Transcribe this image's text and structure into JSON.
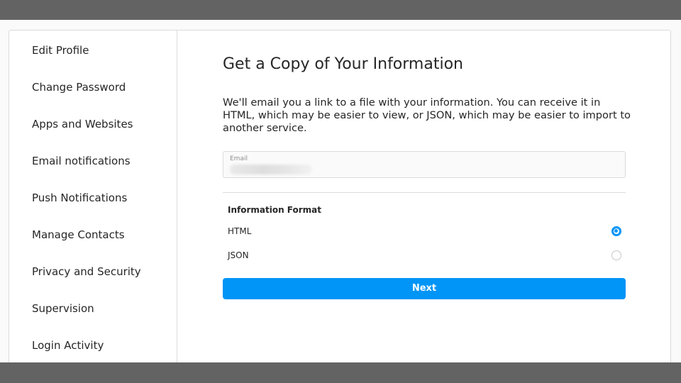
{
  "sidebar": {
    "items": [
      {
        "label": "Edit Profile"
      },
      {
        "label": "Change Password"
      },
      {
        "label": "Apps and Websites"
      },
      {
        "label": "Email notifications"
      },
      {
        "label": "Push Notifications"
      },
      {
        "label": "Manage Contacts"
      },
      {
        "label": "Privacy and Security"
      },
      {
        "label": "Supervision"
      },
      {
        "label": "Login Activity"
      }
    ]
  },
  "main": {
    "title": "Get a Copy of Your Information",
    "description": "We'll email you a link to a file with your information. You can receive it in HTML, which may be easier to view, or JSON, which may be easier to import to another service.",
    "email": {
      "label": "Email",
      "value": ""
    },
    "format": {
      "heading": "Information Format",
      "options": [
        {
          "label": "HTML",
          "selected": true
        },
        {
          "label": "JSON",
          "selected": false
        }
      ]
    },
    "next_label": "Next"
  },
  "colors": {
    "accent": "#0095f6",
    "border": "#dbdbdb",
    "chrome_bar": "#636363",
    "text": "#262626"
  }
}
